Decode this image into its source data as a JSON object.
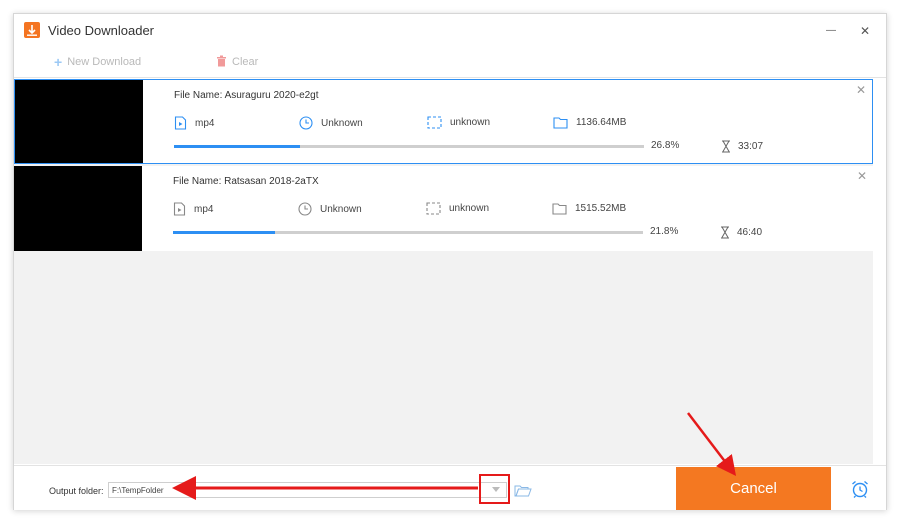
{
  "window": {
    "title": "Video Downloader",
    "minimize_label": "—",
    "close_label": "✕"
  },
  "toolbar": {
    "new_download_label": "New Download",
    "clear_label": "Clear"
  },
  "tasks": [
    {
      "file_name": "File Name: Asuraguru 2020-e2gt",
      "format": "mp4",
      "duration": "Unknown",
      "resolution": "unknown",
      "size": "1136.64MB",
      "progress_percent": "26.8%",
      "progress_fraction": 0.268,
      "remaining_time": "33:07",
      "selected": true
    },
    {
      "file_name": "File Name: Ratsasan 2018-2aTX",
      "format": "mp4",
      "duration": "Unknown",
      "resolution": "unknown",
      "size": "1515.52MB",
      "progress_percent": "21.8%",
      "progress_fraction": 0.218,
      "remaining_time": "46:40",
      "selected": false
    }
  ],
  "footer": {
    "output_folder_label": "Output folder:",
    "output_folder_value": "F:\\TempFolder",
    "cancel_label": "Cancel"
  },
  "colors": {
    "accent_blue": "#2d8ff3",
    "cancel_orange": "#f47821",
    "annotation_red": "#e51a1a"
  },
  "icons": {
    "app": "video-downloader-icon",
    "format": "video-file-icon",
    "duration": "clock-icon",
    "resolution": "resolution-frame-icon",
    "size": "folder-size-icon",
    "eta": "hourglass-icon",
    "browse": "folder-open-icon",
    "alarm": "alarm-clock-icon"
  }
}
